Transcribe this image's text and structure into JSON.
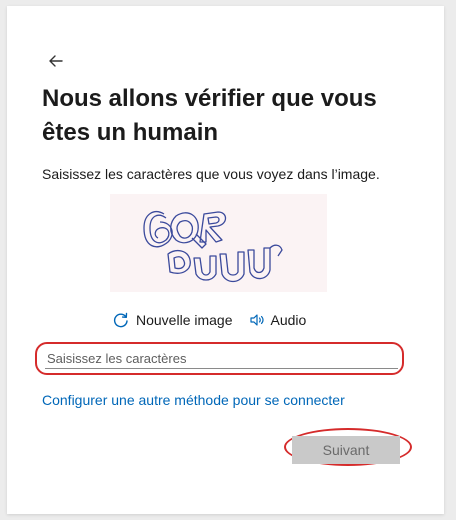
{
  "header": {
    "title": "Nous allons vérifier que vous êtes un humain",
    "description": "Saisissez les caractères que vous voyez dans l’image."
  },
  "captcha": {
    "reload_label": "Nouvelle image",
    "audio_label": "Audio"
  },
  "form": {
    "input_placeholder": "Saisissez les caractères",
    "input_value": ""
  },
  "links": {
    "alternate_signin": "Configurer une autre méthode pour se connecter"
  },
  "actions": {
    "next_label": "Suivant"
  },
  "colors": {
    "link": "#0067b8",
    "highlight": "#d52b2b",
    "button_disabled_bg": "#c9c9c9",
    "captcha_bg": "#fbf3f4"
  },
  "icons": {
    "back": "arrow-left-icon",
    "reload": "refresh-icon",
    "audio": "speaker-icon"
  }
}
